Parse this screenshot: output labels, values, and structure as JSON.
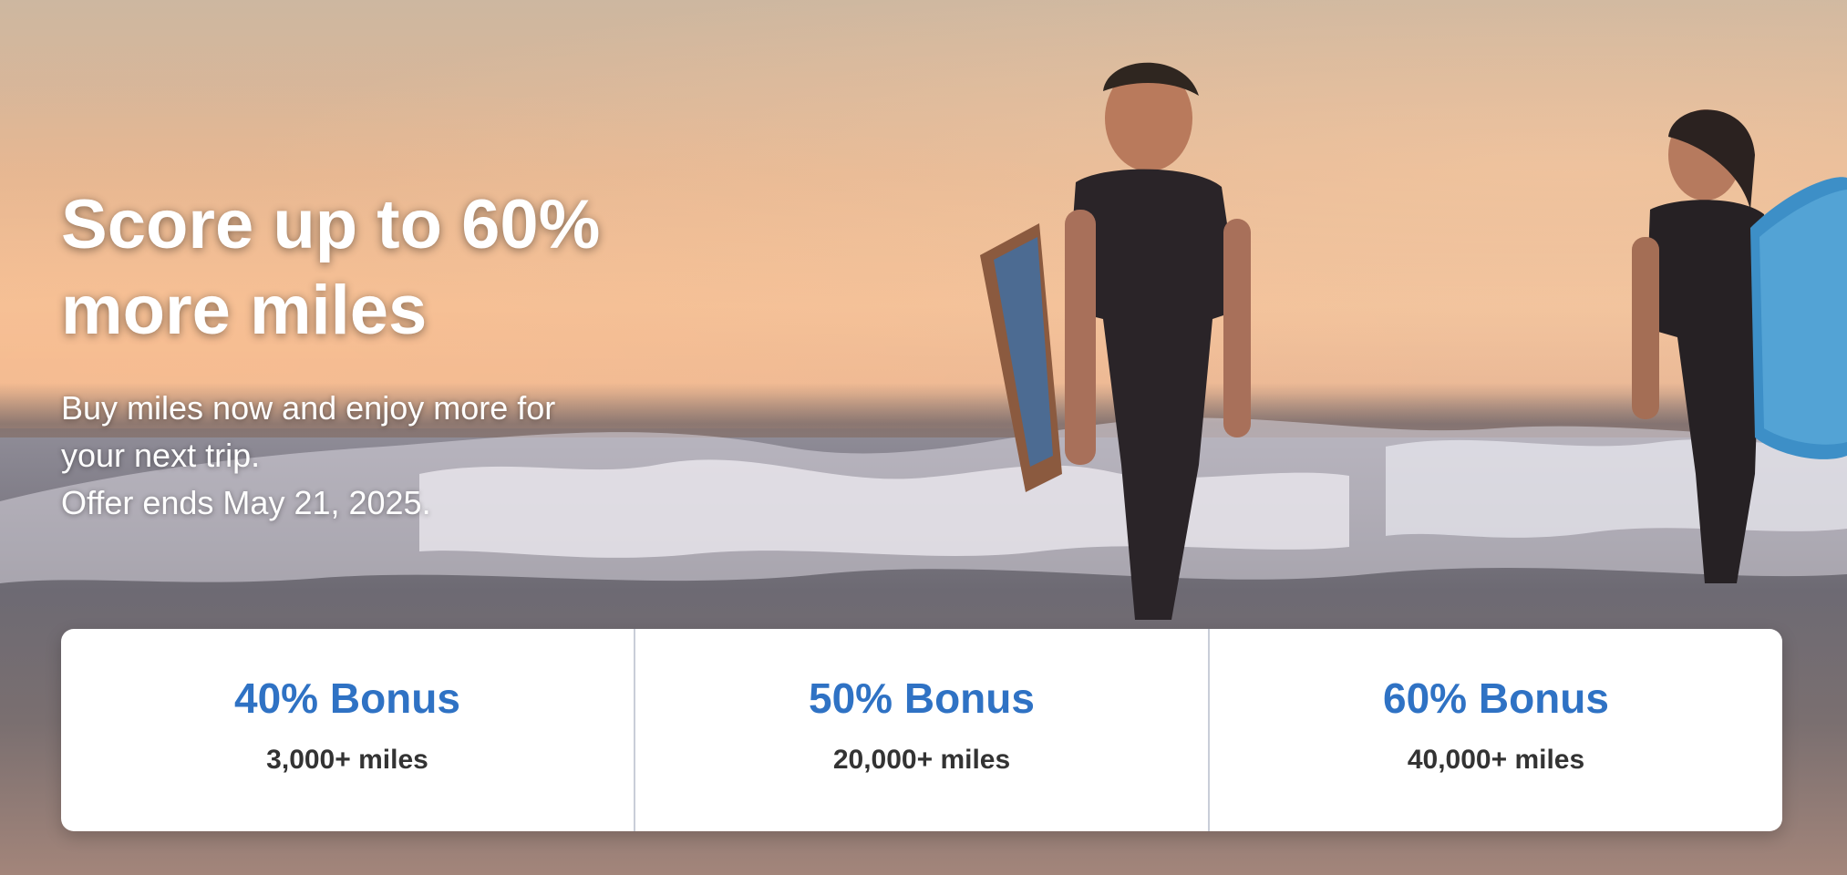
{
  "hero": {
    "headline": "Score up to 60% more miles",
    "subtext_lines": [
      "Buy miles now and enjoy more for",
      "your next trip.",
      "Offer ends May 21, 2025."
    ]
  },
  "offers": [
    {
      "title": "40% Bonus",
      "miles": "3,000+ miles"
    },
    {
      "title": "50% Bonus",
      "miles": "20,000+ miles"
    },
    {
      "title": "60% Bonus",
      "miles": "40,000+ miles"
    }
  ],
  "colors": {
    "accent": "#2f72c4",
    "miles_text": "#333333",
    "card_background": "#ffffff"
  }
}
